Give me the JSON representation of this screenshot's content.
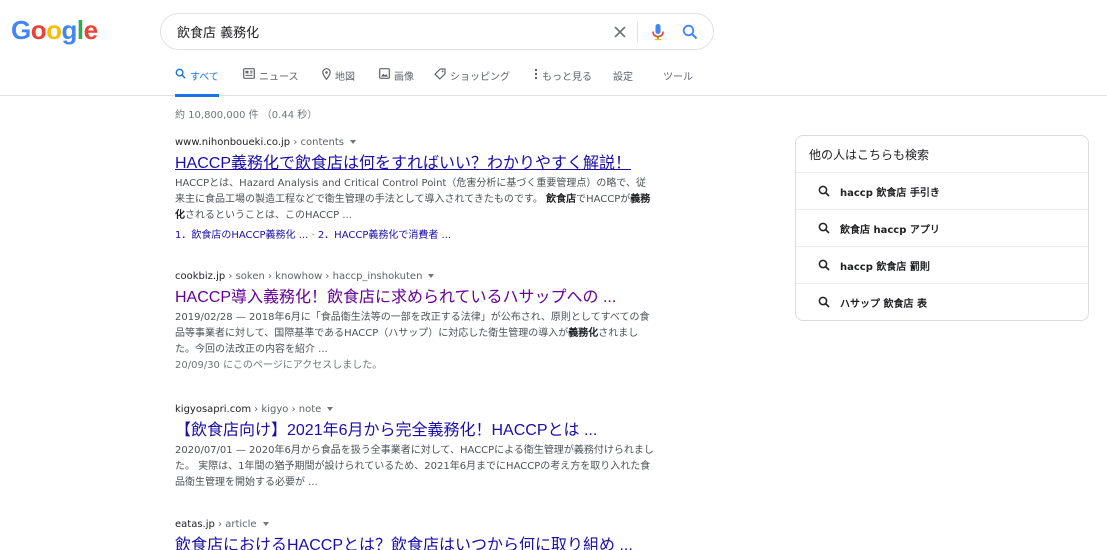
{
  "logo": {
    "letters": [
      "G",
      "o",
      "o",
      "g",
      "l",
      "e"
    ]
  },
  "search": {
    "query": "飲食店 義務化"
  },
  "tabs": [
    {
      "label": "すべて",
      "icon": "search-icon"
    },
    {
      "label": "ニュース",
      "icon": "news-icon"
    },
    {
      "label": "地図",
      "icon": "map-pin-icon"
    },
    {
      "label": "画像",
      "icon": "image-icon"
    },
    {
      "label": "ショッピング",
      "icon": "tag-icon"
    },
    {
      "label": "もっと見る",
      "icon": "more-vert-icon"
    },
    {
      "label": "設定",
      "icon": ""
    },
    {
      "label": "ツール",
      "icon": ""
    }
  ],
  "stats": "約 10,800,000 件 （0.44 秒）",
  "results": [
    {
      "domain": "www.nihonboueki.co.jp",
      "path": " › contents",
      "title": "HACCP義務化で飲食店は何をすればいい？わかりやすく解説！",
      "snippet_parts": [
        "HACCPとは、Hazard Analysis and Critical Control Point（危害分析に基づく重要管理点）の略で、従来主に食品工場の製造工程などで衛生管理の手法として導入されてきたものです。",
        "飲食店",
        "でHACCPが",
        "義務化",
        "されるということは、このHACCP ..."
      ],
      "sitelink_1": "1．飲食店のHACCP義務化 ...",
      "sitelink_sep": " · ",
      "sitelink_2": "2．HACCP義務化で消費者 ..."
    },
    {
      "domain": "cookbiz.jp",
      "path": " › soken › knowhow › haccp_inshokuten",
      "title": "HACCP導入義務化！飲食店に求められているハサップへの ...",
      "snippet_parts": [
        "2019/02/28 — 2018年6月に「食品衛生法等の一部を改正する法律」が公布され、原則としてすべての食品等事業者に対して、国際基準であるHACCP（ハサップ）に対応した衛生管理の導入が",
        "義務化",
        "されました。今回の法改正の内容を紹介 ..."
      ],
      "visit_note": "20/09/30 にこのページにアクセスしました。"
    },
    {
      "domain": "kigyosapri.com",
      "path": " › kigyo › note",
      "title": "【飲食店向け】2021年6月から完全義務化！HACCPとは ...",
      "snippet_parts": [
        "2020/07/01 — 2020年6月から食品を扱う全事業者に対して、HACCPによる衛生管理が義務付けられました。 実際は、1年間の猶予期間が設けられているため、2021年6月までにHACCPの考え方を取り入れた食品衛生管理を開始する必要が ..."
      ]
    },
    {
      "domain": "eatas.jp",
      "path": " › article",
      "title": "飲食店におけるHACCPとは？飲食店はいつから何に取り組め ..."
    }
  ],
  "related": {
    "title": "他の人はこちらも検索",
    "items": [
      {
        "pre": "haccp ",
        "bold": "飲食店",
        "post": " 手引き"
      },
      {
        "pre": "",
        "bold": "飲食店",
        "post": " haccp アプリ"
      },
      {
        "pre": "haccp ",
        "bold": "飲食店",
        "post": " 罰則"
      },
      {
        "pre": "ハサップ ",
        "bold": "飲食店",
        "post": " 表"
      }
    ]
  },
  "colors": {
    "link": "#1a0dab",
    "visited": "#660099",
    "accent": "#1a73e8",
    "logo": [
      "#4285f4",
      "#ea4335",
      "#fbbc05",
      "#4285f4",
      "#34a853",
      "#ea4335"
    ]
  }
}
